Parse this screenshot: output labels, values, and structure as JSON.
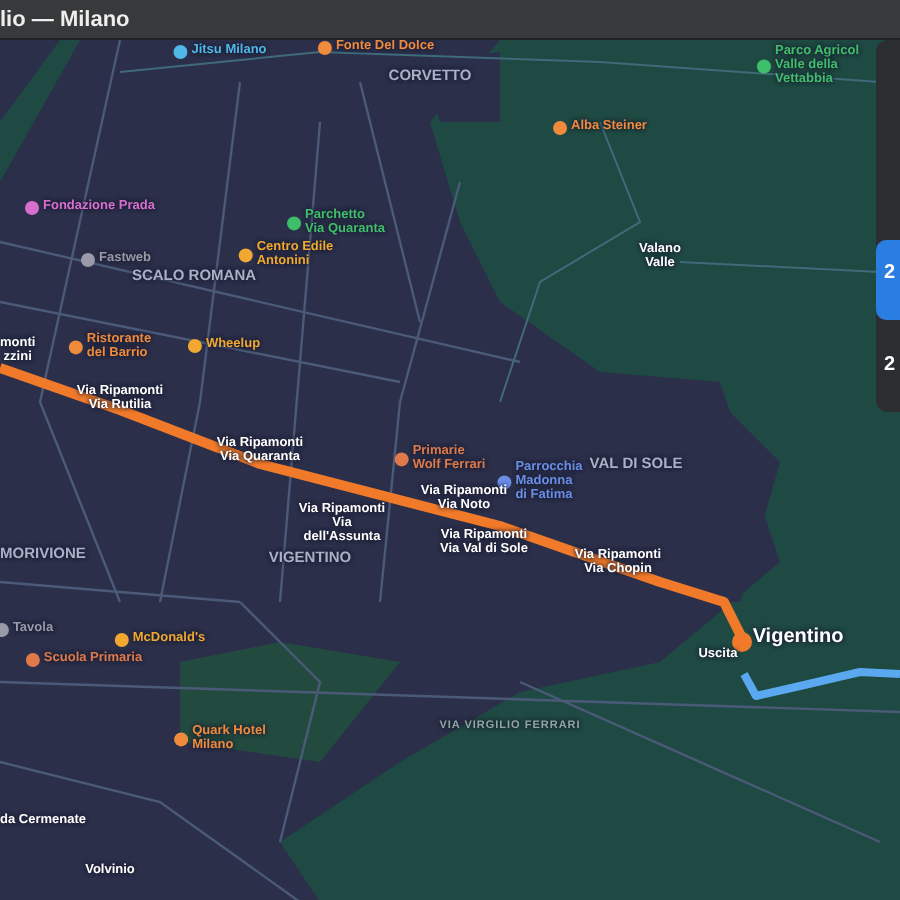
{
  "window": {
    "title": "lio — Milano"
  },
  "map": {
    "labels": [
      {
        "kind": "poi",
        "text": "Jitsu Milano",
        "color": "#4fb8e8"
      },
      {
        "kind": "poi",
        "text": "Fonte Del Dolce",
        "color": "#f08a3c"
      },
      {
        "kind": "district",
        "text": "CORVETTO"
      },
      {
        "kind": "poi",
        "text": "Alba Steiner",
        "color": "#f08a3c"
      },
      {
        "kind": "poi",
        "text": "Parco Agricol\nValle della\nVettabbia",
        "color": "#3fbf6a"
      },
      {
        "kind": "poi",
        "text": "Fondazione Prada",
        "color": "#d86fd0"
      },
      {
        "kind": "poi",
        "text": "Parchetto\nVia Quaranta",
        "color": "#3fbf6a"
      },
      {
        "kind": "poi",
        "text": "Fastweb",
        "color": "#9a9aa8"
      },
      {
        "kind": "poi",
        "text": "Centro Edile\nAntonini",
        "color": "#f0a830"
      },
      {
        "kind": "district",
        "text": "SCALO ROMANA"
      },
      {
        "kind": "place",
        "text": "Valano\nValle"
      },
      {
        "kind": "stop",
        "text": "monti\nzzini"
      },
      {
        "kind": "poi",
        "text": "Ristorante\ndel Barrio",
        "color": "#f08a3c"
      },
      {
        "kind": "poi",
        "text": "Wheelup",
        "color": "#f0a830"
      },
      {
        "kind": "stop",
        "text": "Via Ripamonti\nVia Rutilia"
      },
      {
        "kind": "stop",
        "text": "Via Ripamonti\nVia Quaranta"
      },
      {
        "kind": "poi",
        "text": "Primarie\nWolf Ferrari",
        "color": "#e07a4a"
      },
      {
        "kind": "poi",
        "text": "Parrocchia\nMadonna\ndi Fatima",
        "color": "#6a8ee8"
      },
      {
        "kind": "district",
        "text": "VAL DI SOLE"
      },
      {
        "kind": "stop",
        "text": "Via Ripamonti\nVia Noto"
      },
      {
        "kind": "stop",
        "text": "Via Ripamonti\nVia\ndell'Assunta"
      },
      {
        "kind": "stop",
        "text": "Via Ripamonti\nVia Val di Sole"
      },
      {
        "kind": "district",
        "text": "MORIVIONE"
      },
      {
        "kind": "district",
        "text": "VIGENTINO"
      },
      {
        "kind": "stop",
        "text": "Via Ripamonti\nVia Chopin"
      },
      {
        "kind": "place",
        "text": "Vigentino"
      },
      {
        "kind": "stop",
        "text": "Uscita"
      },
      {
        "kind": "poi",
        "text": "Tavola",
        "color": "#9a9aa8"
      },
      {
        "kind": "poi",
        "text": "McDonald's",
        "color": "#f0a830"
      },
      {
        "kind": "poi",
        "text": "Scuola Primaria",
        "color": "#e07a4a"
      },
      {
        "kind": "poi",
        "text": "Quark Hotel\nMilano",
        "color": "#f08a3c"
      },
      {
        "kind": "street",
        "text": "VIA VIRGILIO FERRARI"
      },
      {
        "kind": "place",
        "text": "da Cermenate"
      },
      {
        "kind": "place",
        "text": "Volvinio"
      }
    ]
  },
  "panel": {
    "routes": [
      {
        "time": "2",
        "selected": true
      },
      {
        "time": "2",
        "selected": false
      }
    ]
  }
}
